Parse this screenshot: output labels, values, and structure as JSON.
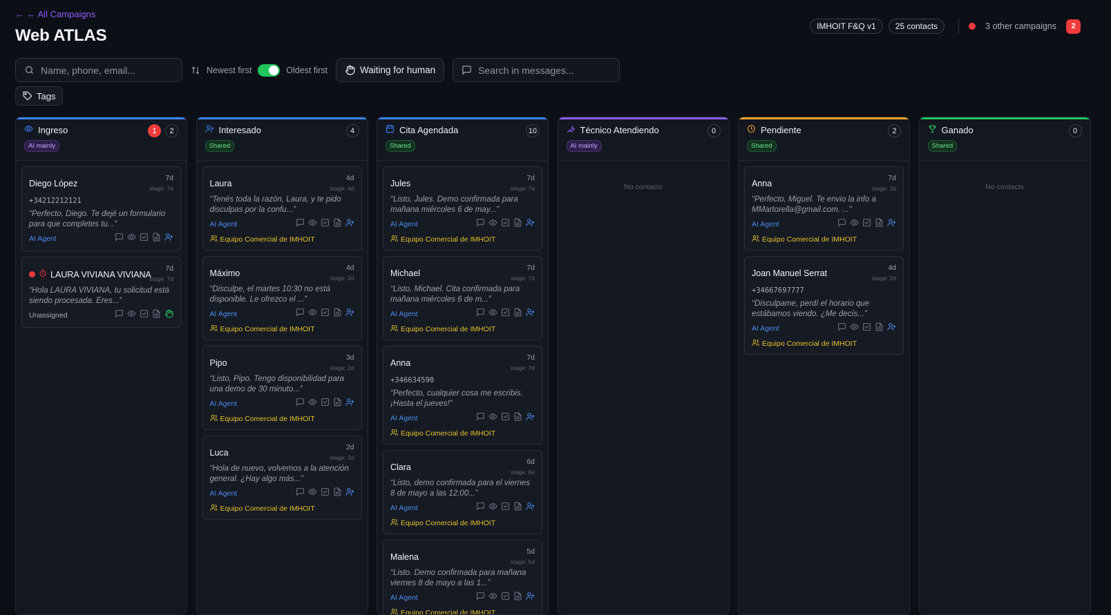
{
  "header": {
    "back_link": "← ← All Campaigns",
    "title": "Web ATLAS",
    "agent_pill": "IMHOIT F&Q v1",
    "contacts_pill": "25 contacts",
    "other_campaigns": "3 other campaigns",
    "other_campaigns_count": "2"
  },
  "toolbar": {
    "search_placeholder": "Name, phone, email...",
    "sort_newest": "Newest first",
    "sort_oldest": "Oldest first",
    "waiting_label": "Waiting for human",
    "msg_search_placeholder": "Search in messages...",
    "tags_label": "Tags"
  },
  "columns": [
    {
      "title": "Ingreso",
      "icon": "eye-icon",
      "color": "#3b82f6",
      "tag": "AI mainly",
      "tag_type": "ai",
      "alert_count": "1",
      "count": "2",
      "cards": [
        {
          "name": "Diego López",
          "age": "7d",
          "stage": "stage: 7d",
          "phone": "+34212212121",
          "msg": "“Perfecto, Diego. Te dejé un formulario para que completes tu...”",
          "agent": "AI Agent",
          "team": ""
        },
        {
          "name": "LAURA VIVIANA VIVIANA",
          "age": "7d",
          "stage": "stage: 7d",
          "phone": "",
          "msg": "“Hola LAURA VIVIANA, tu solicitud está siendo procesada. Eres...”",
          "agent": "Unassigned",
          "team": "",
          "flagged": true
        }
      ]
    },
    {
      "title": "Interesado",
      "icon": "user-plus-icon",
      "color": "#3b82f6",
      "tag": "Shared",
      "tag_type": "shared",
      "count": "4",
      "cards": [
        {
          "name": "Laura",
          "age": "4d",
          "stage": "stage: 4d",
          "phone": "",
          "msg": "“Tenés toda la razón, Laura, y te pido disculpas por la confu...”",
          "agent": "AI Agent",
          "team": "Equipo Comercial de IMHOIT"
        },
        {
          "name": "Máximo",
          "age": "4d",
          "stage": "stage: 2d",
          "phone": "",
          "msg": "“Disculpe, el martes 10:30 no está disponible. Le ofrezco el ...”",
          "agent": "AI Agent",
          "team": "Equipo Comercial de IMHOIT"
        },
        {
          "name": "Pipo",
          "age": "3d",
          "stage": "stage: 2d",
          "phone": "",
          "msg": "“Listo, Pipo. Tengo disponibilidad para una demo de 30 minuto...”",
          "agent": "AI Agent",
          "team": "Equipo Comercial de IMHOIT"
        },
        {
          "name": "Luca",
          "age": "2d",
          "stage": "stage: 2d",
          "phone": "",
          "msg": "“Hola de nuevo, volvemos a la atención general. ¿Hay algo más...”",
          "agent": "AI Agent",
          "team": "Equipo Comercial de IMHOIT"
        }
      ]
    },
    {
      "title": "Cita Agendada",
      "icon": "calendar-icon",
      "color": "#3b82f6",
      "tag": "Shared",
      "tag_type": "shared",
      "count": "10",
      "cards": [
        {
          "name": "Jules",
          "age": "7d",
          "stage": "stage: 7d",
          "phone": "",
          "msg": "“Listo, Jules. Demo confirmada para mañana miércoles 6 de may...”",
          "agent": "AI Agent",
          "team": "Equipo Comercial de IMHOIT"
        },
        {
          "name": "Michael",
          "age": "7d",
          "stage": "stage: 7d",
          "phone": "",
          "msg": "“Listo, Michael. Cita confirmada para mañana miércoles 6 de m...”",
          "agent": "AI Agent",
          "team": "Equipo Comercial de IMHOIT"
        },
        {
          "name": "Anna",
          "age": "7d",
          "stage": "stage: 7d",
          "phone": "+346634590",
          "msg": "“Perfecto, cualquier cosa me escribis. ¡Hasta el jueves!”",
          "agent": "AI Agent",
          "team": "Equipo Comercial de IMHOIT"
        },
        {
          "name": "Clara",
          "age": "6d",
          "stage": "stage: 6d",
          "phone": "",
          "msg": "“Listo, demo confirmada para el viernes 8 de mayo a las 12:00...”",
          "agent": "AI Agent",
          "team": "Equipo Comercial de IMHOIT"
        },
        {
          "name": "Malena",
          "age": "5d",
          "stage": "stage: 5d",
          "phone": "",
          "msg": "“Listo. Demo confirmada para mañana viernes 8 de mayo a las 1...”",
          "agent": "AI Agent",
          "team": "Equipo Comercial de IMHOIT"
        }
      ]
    },
    {
      "title": "Técnico Atendiendo",
      "icon": "wrench-icon",
      "color": "#8b5cf6",
      "tag": "AI mainly",
      "tag_type": "ai",
      "count": "0",
      "empty": "No contacts",
      "cards": []
    },
    {
      "title": "Pendiente",
      "icon": "clock-icon",
      "color": "#f5a524",
      "tag": "Shared",
      "tag_type": "shared",
      "count": "2",
      "cards": [
        {
          "name": "Anna",
          "age": "7d",
          "stage": "stage: 2d",
          "phone": "",
          "msg": "“Perfecto, Miguel. Te envio la info a MMartorella@gmail.com. ...”",
          "agent": "AI Agent",
          "team": "Equipo Comercial de IMHOIT"
        },
        {
          "name": "Joan Manuel Serrat",
          "age": "4d",
          "stage": "stage: 2d",
          "phone": "+34667697777",
          "msg": "“Disculpame, perdí el horario que estábamos viendo. ¿Me decís...”",
          "agent": "AI Agent",
          "team": "Equipo Comercial de IMHOIT"
        }
      ]
    },
    {
      "title": "Ganado",
      "icon": "trophy-icon",
      "color": "#22c55e",
      "tag": "Shared",
      "tag_type": "shared",
      "count": "0",
      "empty": "No contacts",
      "cards": []
    }
  ]
}
